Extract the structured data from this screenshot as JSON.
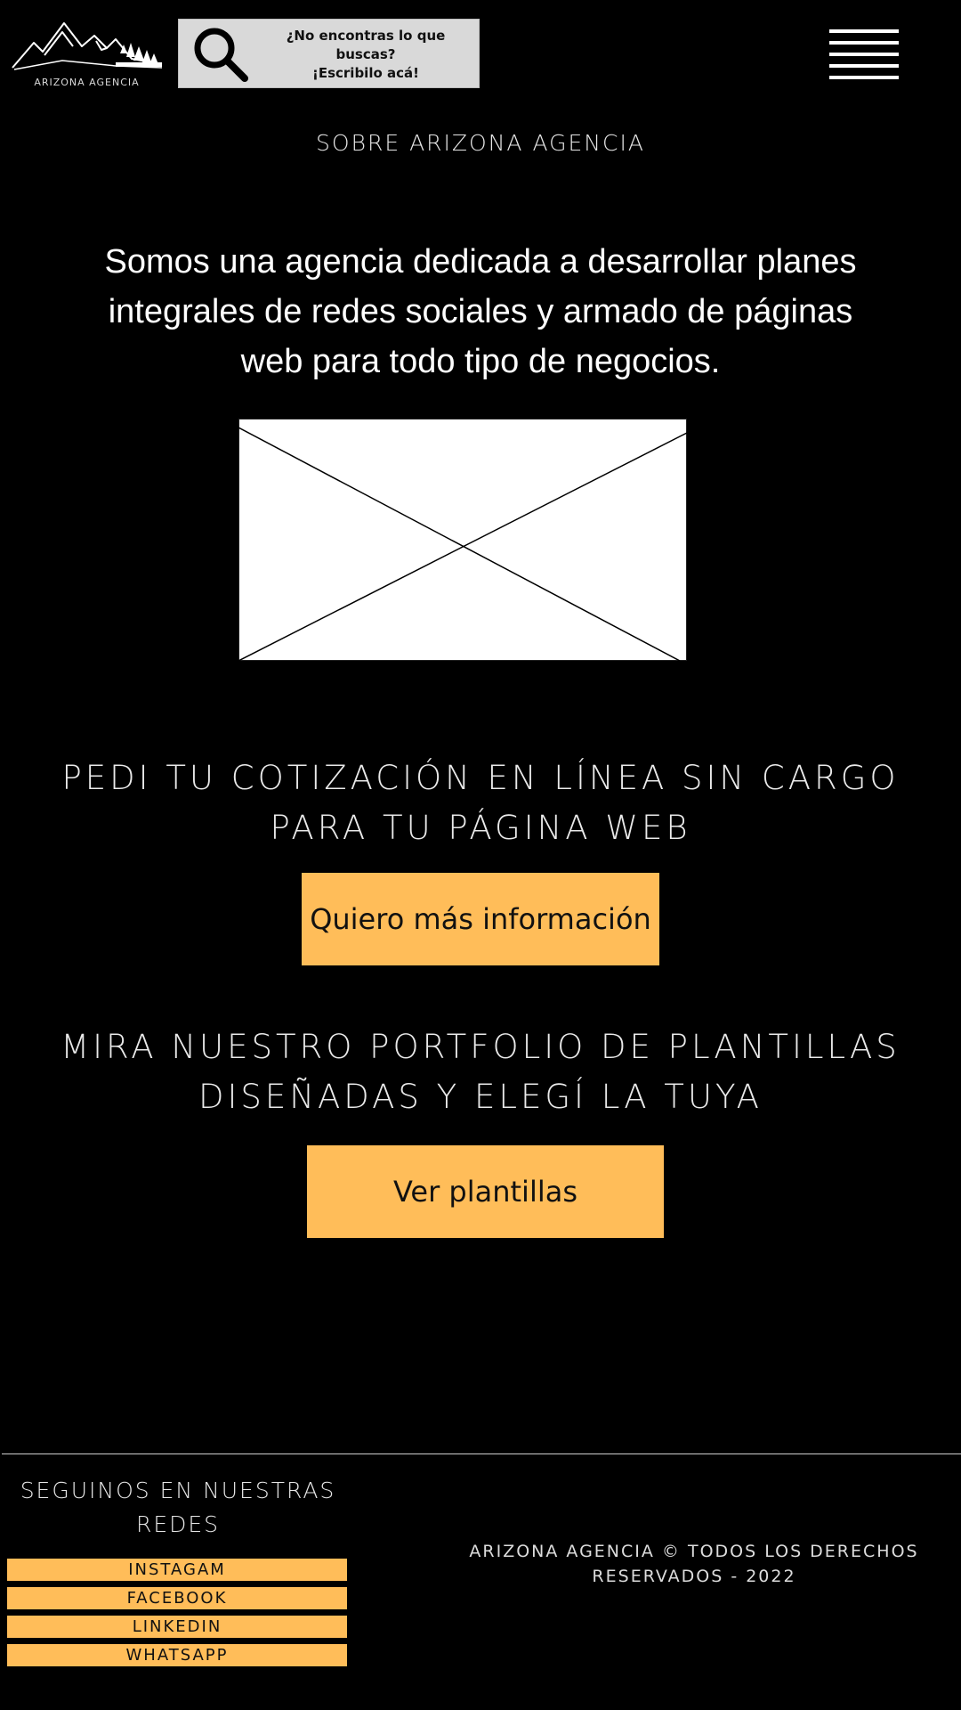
{
  "header": {
    "logo_text": "ARIZONA AGENCIA",
    "search": {
      "icon": "search-icon",
      "line1": "¿No encontras lo que",
      "line2": "buscas?",
      "line3": "¡Escribilo acá!"
    },
    "menu_icon": "hamburger-menu-icon"
  },
  "main": {
    "section_title": "SOBRE ARIZONA AGENCIA",
    "intro": {
      "line1": "Somos una agencia dedicada a desarrollar planes",
      "line2": "integrales de redes sociales y armado de páginas",
      "line3": "web para todo tipo de negocios."
    },
    "image_placeholder_icon": "image-placeholder-icon",
    "cta_quote": {
      "line1": "PEDI TU COTIZACIÓN EN LÍNEA SIN CARGO",
      "line2": "PARA TU PÁGINA WEB",
      "button_label": "Quiero más información"
    },
    "cta_portfolio": {
      "line1": "MIRA NUESTRO PORTFOLIO DE  PLANTILLAS",
      "line2": "DISEÑADAS Y ELEGÍ LA TUYA",
      "button_label": "Ver plantillas"
    }
  },
  "footer": {
    "social_heading_line1": "SEGUINOS EN NUESTRAS",
    "social_heading_line2": "REDES",
    "social_links": [
      "INSTAGAM",
      "FACEBOOK",
      "LINKEDIN",
      "WHATSAPP"
    ],
    "copyright_line1": "ARIZONA AGENCIA © TODOS LOS DERECHOS",
    "copyright_line2": "RESERVADOS - 2022"
  },
  "colors": {
    "background": "#000000",
    "accent": "#ffbd59",
    "text": "#ffffff",
    "search_bg": "#d9d9d9"
  }
}
